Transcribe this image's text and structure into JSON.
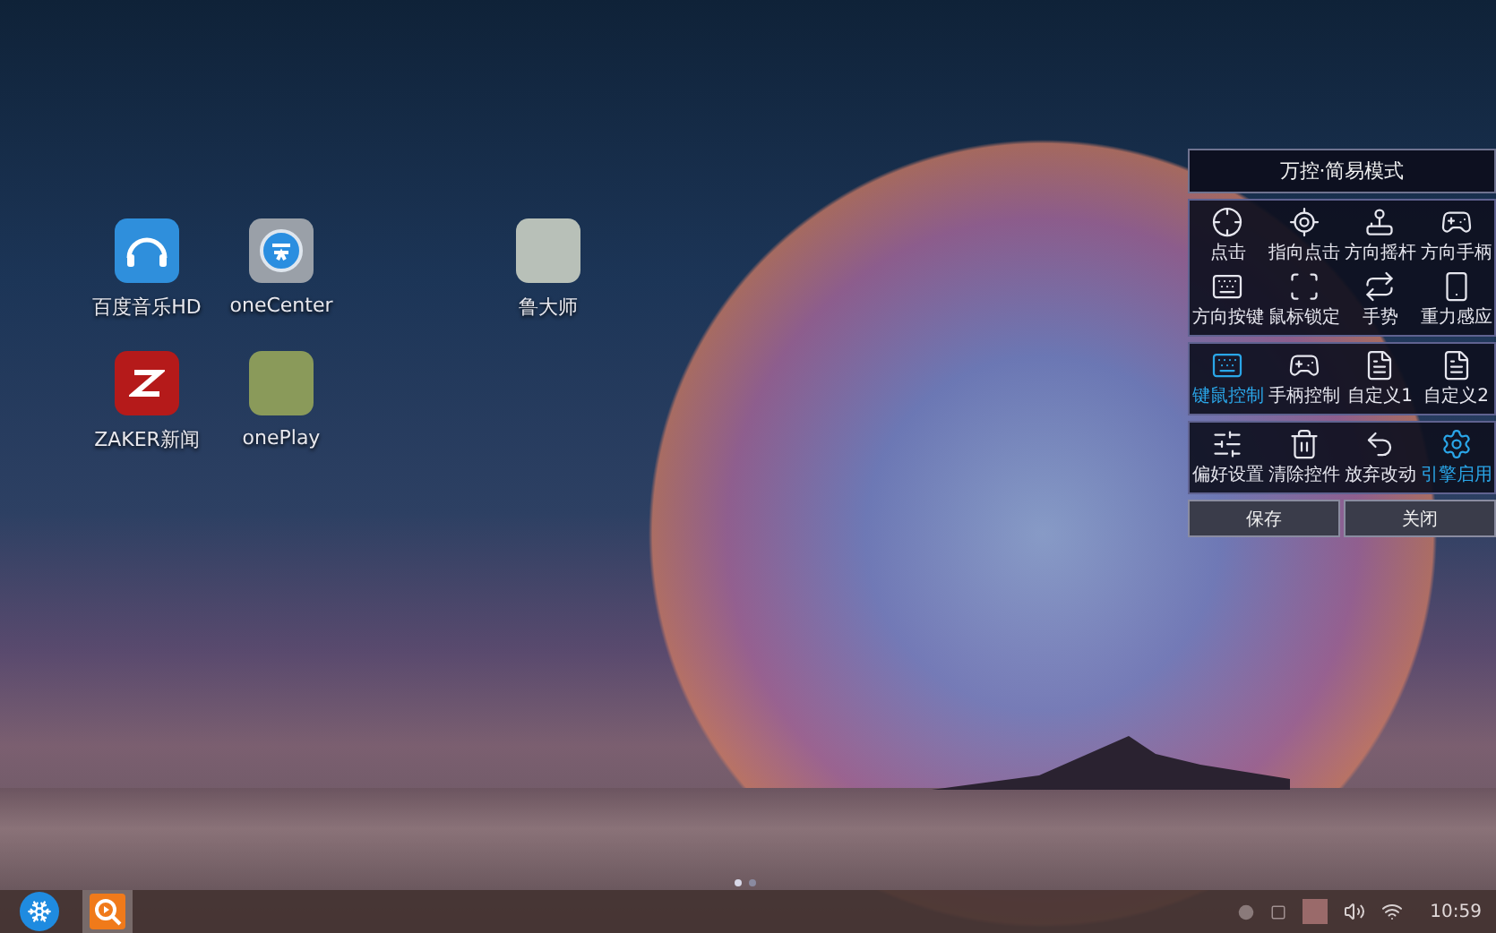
{
  "desktop_icons": [
    {
      "label": "百度音乐HD",
      "kind": "music"
    },
    {
      "label": "oneCenter",
      "kind": "center"
    },
    {
      "label": "鲁大师",
      "kind": "cartoon"
    },
    {
      "label": "ZAKER新闻",
      "kind": "zaker"
    },
    {
      "label": "onePlay",
      "kind": "photo"
    }
  ],
  "page_dots": [
    {
      "selected": true
    },
    {
      "selected": false
    }
  ],
  "panel": {
    "title": "万控·简易模式",
    "sections": [
      [
        {
          "label": "点击",
          "highlighted": false
        },
        {
          "label": "指向点击",
          "highlighted": false
        },
        {
          "label": "方向摇杆",
          "highlighted": false
        },
        {
          "label": "方向手柄",
          "highlighted": false
        },
        {
          "label": "方向按键",
          "highlighted": false
        },
        {
          "label": "鼠标锁定",
          "highlighted": false
        },
        {
          "label": "手势",
          "highlighted": false
        },
        {
          "label": "重力感应",
          "highlighted": false
        }
      ],
      [
        {
          "label": "键鼠控制",
          "highlighted": true
        },
        {
          "label": "手柄控制",
          "highlighted": false
        },
        {
          "label": "自定义1",
          "highlighted": false
        },
        {
          "label": "自定义2",
          "highlighted": false
        }
      ],
      [
        {
          "label": "偏好设置",
          "highlighted": false
        },
        {
          "label": "清除控件",
          "highlighted": false
        },
        {
          "label": "放弃改动",
          "highlighted": false
        },
        {
          "label": "引擎启用",
          "highlighted": true
        }
      ]
    ],
    "buttons": [
      "保存",
      "关闭"
    ]
  },
  "taskbar": {
    "apps": [
      {
        "kind": "start",
        "selected": false
      },
      {
        "kind": "player",
        "selected": true
      }
    ],
    "clock": "10:59"
  }
}
